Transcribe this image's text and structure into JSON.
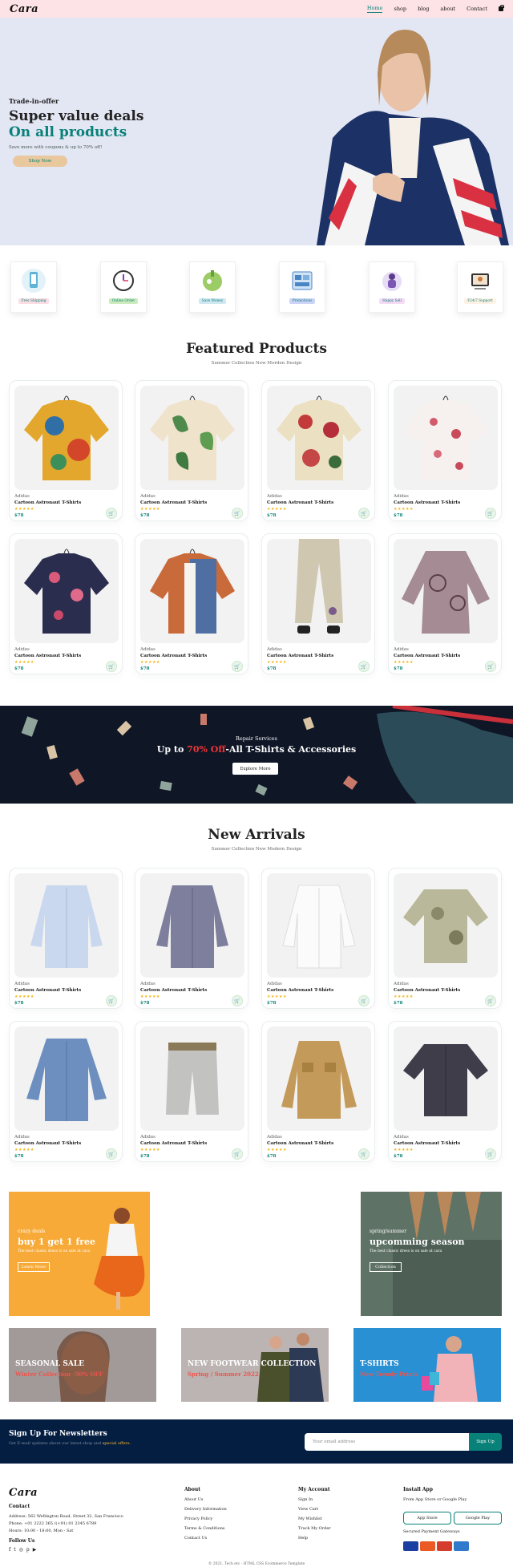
{
  "header": {
    "logo": "Cara",
    "nav": [
      "Home",
      "shop",
      "blog",
      "about",
      "Contact"
    ],
    "active": "Home"
  },
  "hero": {
    "kicker": "Trade-in-offer",
    "title1": "Super value deals",
    "title2": "On all products",
    "sub": "Save more with coupons & up to 70% off!",
    "button": "Shop Now"
  },
  "features": [
    {
      "label": "Free Shipping",
      "bg": "#fddde4"
    },
    {
      "label": "Online Order",
      "bg": "#cdebbc"
    },
    {
      "label": "Save Money",
      "bg": "#d1e8f2"
    },
    {
      "label": "Promotions",
      "bg": "#cdd4f8"
    },
    {
      "label": "Happy Sell",
      "bg": "#f6dbf6"
    },
    {
      "label": "F24/7 Support",
      "bg": "#fff2e5"
    }
  ],
  "featured": {
    "title": "Featured Products",
    "subtitle": "Summer Collection New Morden Design",
    "products": [
      {
        "brand": "Adidas",
        "name": "Cartoon Astronaut T-Shirts",
        "stars": "★★★★★",
        "price": "$78"
      },
      {
        "brand": "Adidas",
        "name": "Cartoon Astronaut T-Shirts",
        "stars": "★★★★★",
        "price": "$78"
      },
      {
        "brand": "Adidas",
        "name": "Cartoon Astronaut T-Shirts",
        "stars": "★★★★★",
        "price": "$78"
      },
      {
        "brand": "Adidas",
        "name": "Cartoon Astronaut T-Shirts",
        "stars": "★★★★★",
        "price": "$78"
      },
      {
        "brand": "Adidas",
        "name": "Cartoon Astronaut T-Shirts",
        "stars": "★★★★★",
        "price": "$78"
      },
      {
        "brand": "Adidas",
        "name": "Cartoon Astronaut T-Shirts",
        "stars": "★★★★★",
        "price": "$78"
      },
      {
        "brand": "Adidas",
        "name": "Cartoon Astronaut T-Shirts",
        "stars": "★★★★★",
        "price": "$78"
      },
      {
        "brand": "Adidas",
        "name": "Cartoon Astronaut T-Shirts",
        "stars": "★★★★★",
        "price": "$78"
      }
    ]
  },
  "repair": {
    "kicker": "Repair Services",
    "title_pre": "Up to ",
    "title_hl": "70% Off",
    "title_post": "-All T-Shirts & Accessories",
    "button": "Explore More"
  },
  "arrivals": {
    "title": "New Arrivals",
    "subtitle": "Summer Collection New Modern Design",
    "products": [
      {
        "brand": "Adidas",
        "name": "Cartoon Astronaut T-Shirts",
        "stars": "★★★★★",
        "price": "$78"
      },
      {
        "brand": "Adidas",
        "name": "Cartoon Astronaut T-Shirts",
        "stars": "★★★★★",
        "price": "$78"
      },
      {
        "brand": "Adidas",
        "name": "Cartoon Astronaut T-Shirts",
        "stars": "★★★★★",
        "price": "$78"
      },
      {
        "brand": "Adidas",
        "name": "Cartoon Astronaut T-Shirts",
        "stars": "★★★★★",
        "price": "$78"
      },
      {
        "brand": "Adidas",
        "name": "Cartoon Astronaut T-Shirts",
        "stars": "★★★★★",
        "price": "$78"
      },
      {
        "brand": "Adidas",
        "name": "Cartoon Astronaut T-Shirts",
        "stars": "★★★★★",
        "price": "$78"
      },
      {
        "brand": "Adidas",
        "name": "Cartoon Astronaut T-Shirts",
        "stars": "★★★★★",
        "price": "$78"
      },
      {
        "brand": "Adidas",
        "name": "Cartoon Astronaut T-Shirts",
        "stars": "★★★★★",
        "price": "$78"
      }
    ]
  },
  "promo": {
    "left": {
      "kicker": "crazy deals",
      "title": "buy 1 get 1 free",
      "sub": "The best classic dress is on sale at cara",
      "button": "Learn More"
    },
    "right": {
      "kicker": "spring/summer",
      "title": "upcomming season",
      "sub": "The best classic dress is on sale at cara",
      "button": "Collection"
    }
  },
  "small_banners": [
    {
      "title": "SEASONAL SALE",
      "sub": "Winter Collection -50% OFF"
    },
    {
      "title": "NEW FOOTWEAR COLLECTION",
      "sub": "Spring / Summer 2022"
    },
    {
      "title": "T-SHIRTS",
      "sub": "New Trendy Prints"
    }
  ],
  "newsletter": {
    "title": "Sign Up For Newsletters",
    "sub_pre": "Get E-mail updates about our latest shop and ",
    "sub_hl": "special offers.",
    "placeholder": "Your email address",
    "button": "Sign Up"
  },
  "footer": {
    "logo": "Cara",
    "contact_title": "Contact",
    "address": "Address: 562 Wellington Road, Street 32, San Francisco",
    "phone": "Phone: +01 2222 365 /(+91) 01 2345 6789",
    "hours": "Hours: 10:00 - 18:00, Mon - Sat",
    "follow": "Follow Us",
    "about_title": "About",
    "about_links": [
      "About Us",
      "Delivery Information",
      "Privacy Policy",
      "Terms & Conditions",
      "Contact Us"
    ],
    "account_title": "My Account",
    "account_links": [
      "Sign In",
      "View Cart",
      "My Wishlist",
      "Track My Order",
      "Help"
    ],
    "app_title": "Install App",
    "app_sub": "From App Store or Google Play",
    "app_store": "App Store",
    "google_play": "Google Play",
    "secured": "Secured Payment Gateways",
    "copyright": "© 2021, Tech etc - HTML CSS Ecommerce Template"
  }
}
